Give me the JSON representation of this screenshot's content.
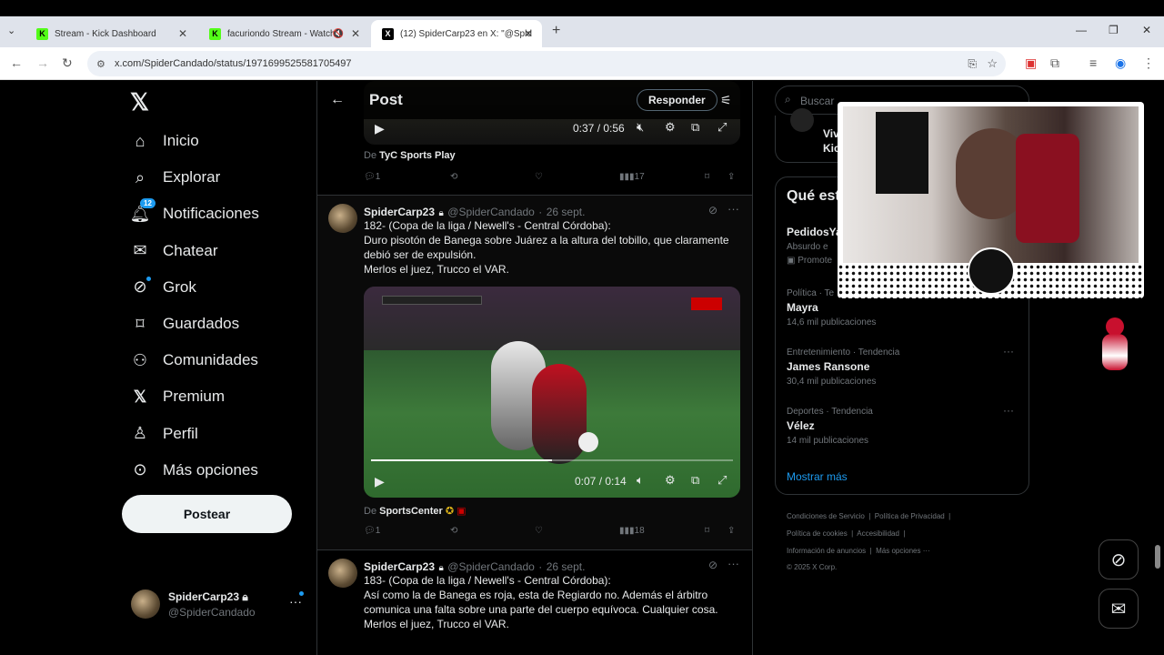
{
  "browser": {
    "tabs": [
      {
        "title": "Stream - Kick Dashboard",
        "fav": "K"
      },
      {
        "title": "facuriondo Stream - Watch",
        "fav": "K"
      },
      {
        "title": "(12) SpiderCarp23 en X: \"@Spid",
        "fav": "X"
      }
    ],
    "url": "x.com/SpiderCandado/status/1971699525581705497"
  },
  "sidebar": {
    "items": [
      {
        "label": "Inicio",
        "icon": "home-icon"
      },
      {
        "label": "Explorar",
        "icon": "search-icon"
      },
      {
        "label": "Notificaciones",
        "icon": "bell-icon",
        "badge": "12"
      },
      {
        "label": "Chatear",
        "icon": "mail-icon"
      },
      {
        "label": "Grok",
        "icon": "grok-icon"
      },
      {
        "label": "Guardados",
        "icon": "bookmark-icon"
      },
      {
        "label": "Comunidades",
        "icon": "people-icon"
      },
      {
        "label": "Premium",
        "icon": "x-logo-icon"
      },
      {
        "label": "Perfil",
        "icon": "user-icon"
      },
      {
        "label": "Más opciones",
        "icon": "more-circle-icon"
      }
    ],
    "post_button": "Postear",
    "account": {
      "name": "SpiderCarp23",
      "handle": "@SpiderCandado"
    }
  },
  "feed": {
    "header_title": "Post",
    "reply_button": "Responder",
    "top_video": {
      "time": "0:37 / 0:56",
      "source_prefix": "De",
      "source": "TyC Sports Play",
      "replies": "1",
      "views": "17"
    },
    "tweets": [
      {
        "name": "SpiderCarp23",
        "handle": "@SpiderCandado",
        "date": "26 sept.",
        "lines": [
          "182- (Copa de la liga / Newell's - Central Córdoba):",
          "Duro pisotón de Banega sobre Juárez a la altura del tobillo, que claramente",
          "debió ser de expulsión.",
          "Merlos el juez, Trucco el VAR."
        ],
        "video_time": "0:07 / 0:14",
        "video_progress": 0.5,
        "source_prefix": "De",
        "source": "SportsCenter",
        "replies": "1",
        "views": "18"
      },
      {
        "name": "SpiderCarp23",
        "handle": "@SpiderCandado",
        "date": "26 sept.",
        "lines": [
          "183- (Copa de la liga / Newell's - Central Córdoba):",
          "Así como la de Banega es roja, esta de Regiardo no. Además el árbitro",
          "comunica una falta sobre una parte del cuerpo equívoca. Cualquier cosa.",
          "Merlos el juez, Trucco el VAR."
        ]
      }
    ]
  },
  "right": {
    "search_placeholder": "Buscar",
    "partial_top": [
      "Viv",
      "Kick"
    ],
    "trends_title": "Qué est",
    "trends": [
      {
        "cat": "",
        "title": "PedidosYa",
        "sub": "Absurdo e",
        "extra": "Promote"
      },
      {
        "cat": "Política · Te",
        "title": "Mayra",
        "count": "14,6 mil publicaciones"
      },
      {
        "cat": "Entretenimiento · Tendencia",
        "title": "James Ransone",
        "count": "30,4 mil publicaciones"
      },
      {
        "cat": "Deportes · Tendencia",
        "title": "Vélez",
        "count": "14 mil publicaciones"
      }
    ],
    "show_more": "Mostrar más",
    "footer": {
      "l1a": "Condiciones de Servicio",
      "l1b": "Política de Privacidad",
      "l2a": "Política de cookies",
      "l2b": "Accesibilidad",
      "l3a": "Información de anuncios",
      "l3b": "Más opciones ···",
      "l4": "© 2025 X Corp."
    }
  },
  "colors": {
    "accent": "#1d9bf0",
    "bg": "#000000",
    "muted": "#71767b"
  }
}
